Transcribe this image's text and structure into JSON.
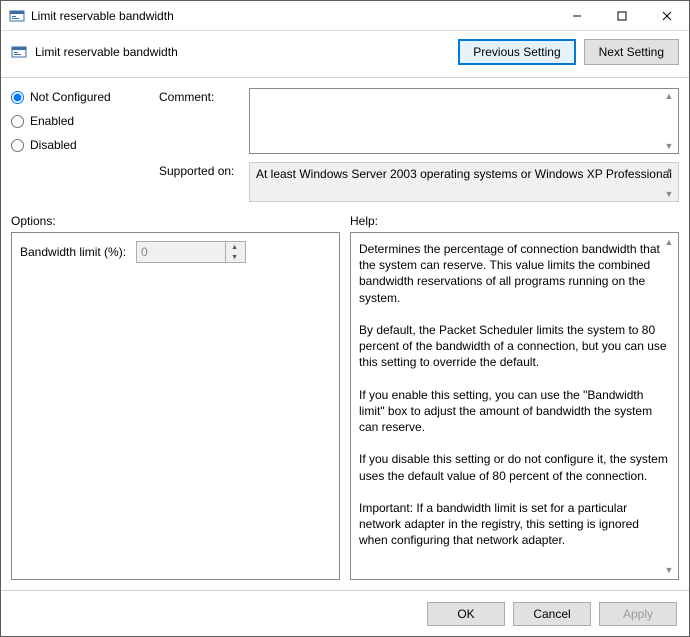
{
  "window": {
    "title": "Limit reservable bandwidth"
  },
  "header": {
    "policy_name": "Limit reservable bandwidth",
    "prev_label": "Previous Setting",
    "next_label": "Next Setting"
  },
  "radios": {
    "not_configured": "Not Configured",
    "enabled": "Enabled",
    "disabled": "Disabled",
    "selected": "not_configured"
  },
  "comment": {
    "label": "Comment:",
    "value": ""
  },
  "supported": {
    "label": "Supported on:",
    "value": "At least Windows Server 2003 operating systems or Windows XP Professional"
  },
  "options": {
    "heading": "Options:",
    "bandwidth_label": "Bandwidth limit (%):",
    "bandwidth_value": "0"
  },
  "help": {
    "heading": "Help:",
    "text": "Determines the percentage of connection bandwidth that the system can reserve. This value limits the combined bandwidth reservations of all programs running on the system.\n\nBy default, the Packet Scheduler limits the system to 80 percent of the bandwidth of a connection, but you can use this setting to override the default.\n\nIf you enable this setting, you can use the \"Bandwidth limit\" box to adjust the amount of bandwidth the system can reserve.\n\nIf you disable this setting or do not configure it, the system uses the default value of 80 percent of the connection.\n\nImportant: If a bandwidth limit is set for a particular network adapter in the registry, this setting is ignored when configuring that network adapter."
  },
  "footer": {
    "ok": "OK",
    "cancel": "Cancel",
    "apply": "Apply"
  }
}
